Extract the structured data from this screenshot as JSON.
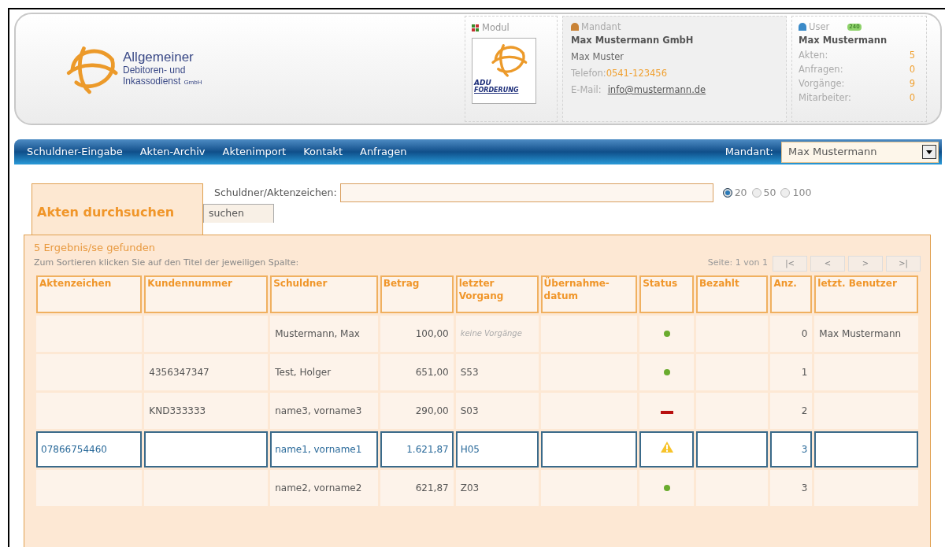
{
  "brand": {
    "lines": [
      "Allgemeiner",
      "Debitoren- und",
      "Inkassodienst"
    ],
    "suffix": "GmbH"
  },
  "module": {
    "label": "Modul",
    "logo_lines": [
      "ADU",
      "FORDERUNG"
    ]
  },
  "mandant_box": {
    "label": "Mandant",
    "company": "Max Mustermann GmbH",
    "contact": "Max Muster",
    "phone_label": "Telefon:",
    "phone": "0541-123456",
    "email_label": "E-Mail:",
    "email": "info@mustermann.de"
  },
  "user_box": {
    "label": "User",
    "badge": "240",
    "name": "Max Mustermann",
    "stats": [
      {
        "label": "Akten:",
        "value": "5"
      },
      {
        "label": "Anfragen:",
        "value": "0"
      },
      {
        "label": "Vorgänge:",
        "value": "9"
      },
      {
        "label": "Mitarbeiter:",
        "value": "0"
      }
    ]
  },
  "nav": {
    "items": [
      "Schuldner-Eingabe",
      "Akten-Archiv",
      "Aktenimport",
      "Kontakt",
      "Anfragen"
    ],
    "mandant_label": "Mandant:",
    "mandant_value": "Max Mustermann"
  },
  "search": {
    "tab": "Akten durchsuchen",
    "field_label": "Schuldner/Aktenzeichen:",
    "button": "suchen",
    "page_sizes": [
      {
        "label": "20",
        "selected": true
      },
      {
        "label": "50",
        "selected": false
      },
      {
        "label": "100",
        "selected": false
      }
    ]
  },
  "results": {
    "count": "5 Ergebnis/se gefunden",
    "hint": "Zum Sortieren klicken Sie auf den Titel der jeweiligen Spalte:",
    "page_info": "Seite: 1 von 1",
    "pager": [
      {
        "label": "|<",
        "disabled": true
      },
      {
        "label": "<",
        "disabled": true
      },
      {
        "label": ">",
        "disabled": true
      },
      {
        "label": ">|",
        "disabled": true
      }
    ]
  },
  "table": {
    "columns": [
      "Aktenzeichen",
      "Kundennummer",
      "Schuldner",
      "Betrag",
      "letzter Vorgang",
      "Übernahme-datum",
      "Status",
      "Bezahlt",
      "Anz.",
      "letzt. Benutzer"
    ],
    "rows": [
      {
        "selected": false,
        "aktenzeichen": "",
        "kundennummer": "",
        "schuldner": "Mustermann, Max",
        "betrag": "100,00",
        "vorgang": "keine Vorgänge",
        "vorgang_muted": true,
        "kind": "ok",
        "anz": "0",
        "benutzer": "Max Mustermann"
      },
      {
        "selected": false,
        "aktenzeichen": "",
        "kundennummer": "4356347347",
        "schuldner": "Test, Holger",
        "betrag": "651,00",
        "vorgang": "S53",
        "vorgang_muted": false,
        "kind": "ok",
        "anz": "1",
        "benutzer": ""
      },
      {
        "selected": false,
        "aktenzeichen": "",
        "kundennummer": "KND333333",
        "schuldner": "name3, vorname3",
        "betrag": "290,00",
        "vorgang": "S03",
        "vorgang_muted": false,
        "kind": "error",
        "anz": "2",
        "benutzer": ""
      },
      {
        "selected": true,
        "aktenzeichen": "07866754460",
        "kundennummer": "",
        "schuldner": "name1, vorname1",
        "betrag": "1.621,87",
        "vorgang": "H05",
        "vorgang_muted": false,
        "kind": "warning",
        "anz": "3",
        "benutzer": ""
      },
      {
        "selected": false,
        "aktenzeichen": "",
        "kundennummer": "",
        "schuldner": "name2, vorname2",
        "betrag": "621,87",
        "vorgang": "Z03",
        "vorgang_muted": false,
        "kind": "ok",
        "anz": "3",
        "benutzer": ""
      }
    ]
  }
}
